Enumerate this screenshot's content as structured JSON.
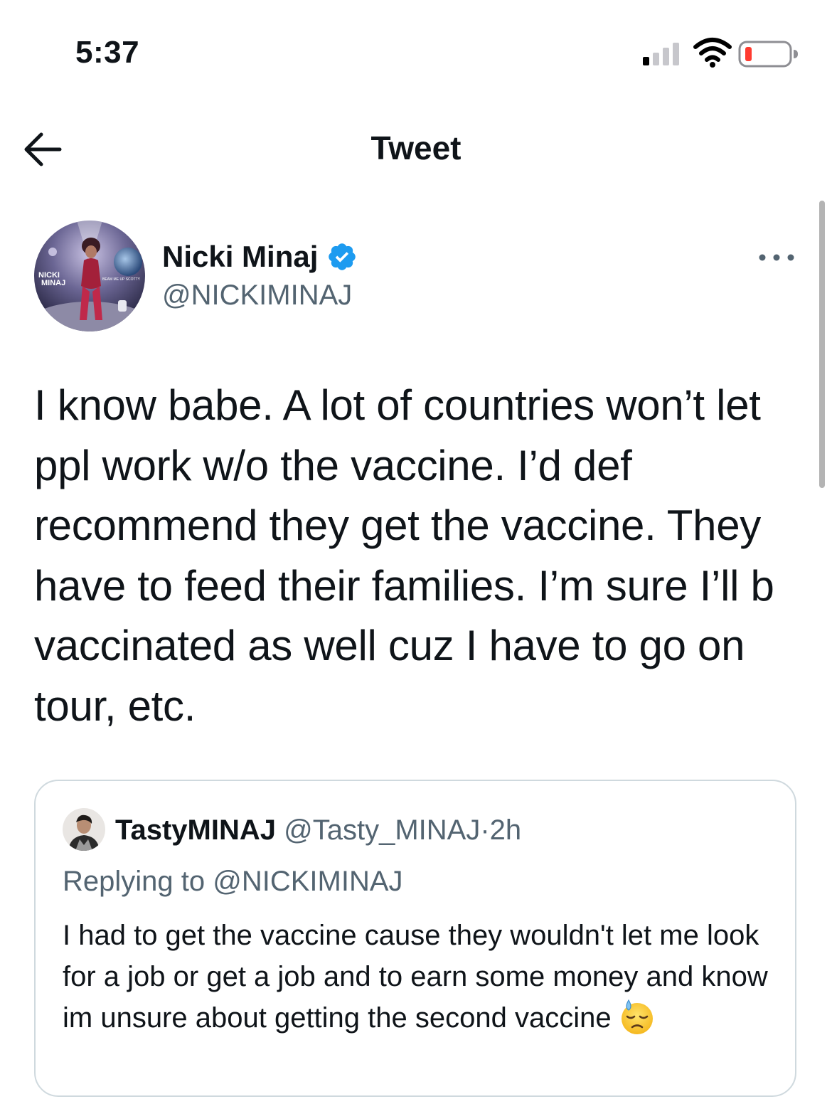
{
  "status_bar": {
    "time": "5:37",
    "signal_icon": "cellular-signal-icon",
    "wifi_icon": "wifi-icon",
    "battery_icon": "battery-low-icon",
    "battery_color": "#ff3b30"
  },
  "header": {
    "title": "Tweet",
    "back_icon": "arrow-left-icon"
  },
  "tweet": {
    "author_name": "Nicki Minaj",
    "author_handle": "@NICKIMINAJ",
    "verified_icon": "verified-badge-icon",
    "verified_color": "#1d9bf0",
    "more_icon": "more-dots-icon",
    "avatar_text": {
      "line1": "NICKI",
      "line2": "MINAJ",
      "tagline": "BEAM ME UP SCOTTY"
    },
    "text": "I know babe. A lot of countries won’t let ppl work w/o the vaccine. I’d def recommend they get the vaccine. They have to feed their families. I’m sure I’ll b vaccinated as well cuz I have to go on tour, etc."
  },
  "quoted_tweet": {
    "author_name": "TastyMINAJ",
    "author_handle": "@Tasty_MINAJ",
    "separator": "·",
    "time": "2h",
    "replying_to_label": "Replying to",
    "replying_to_handle": "@NICKIMINAJ",
    "text": "I had to get the vaccine cause they wouldn't let me look for a job or get a job and to earn some money and know im unsure about getting the second vaccine",
    "emoji": "sweat-emoji"
  }
}
